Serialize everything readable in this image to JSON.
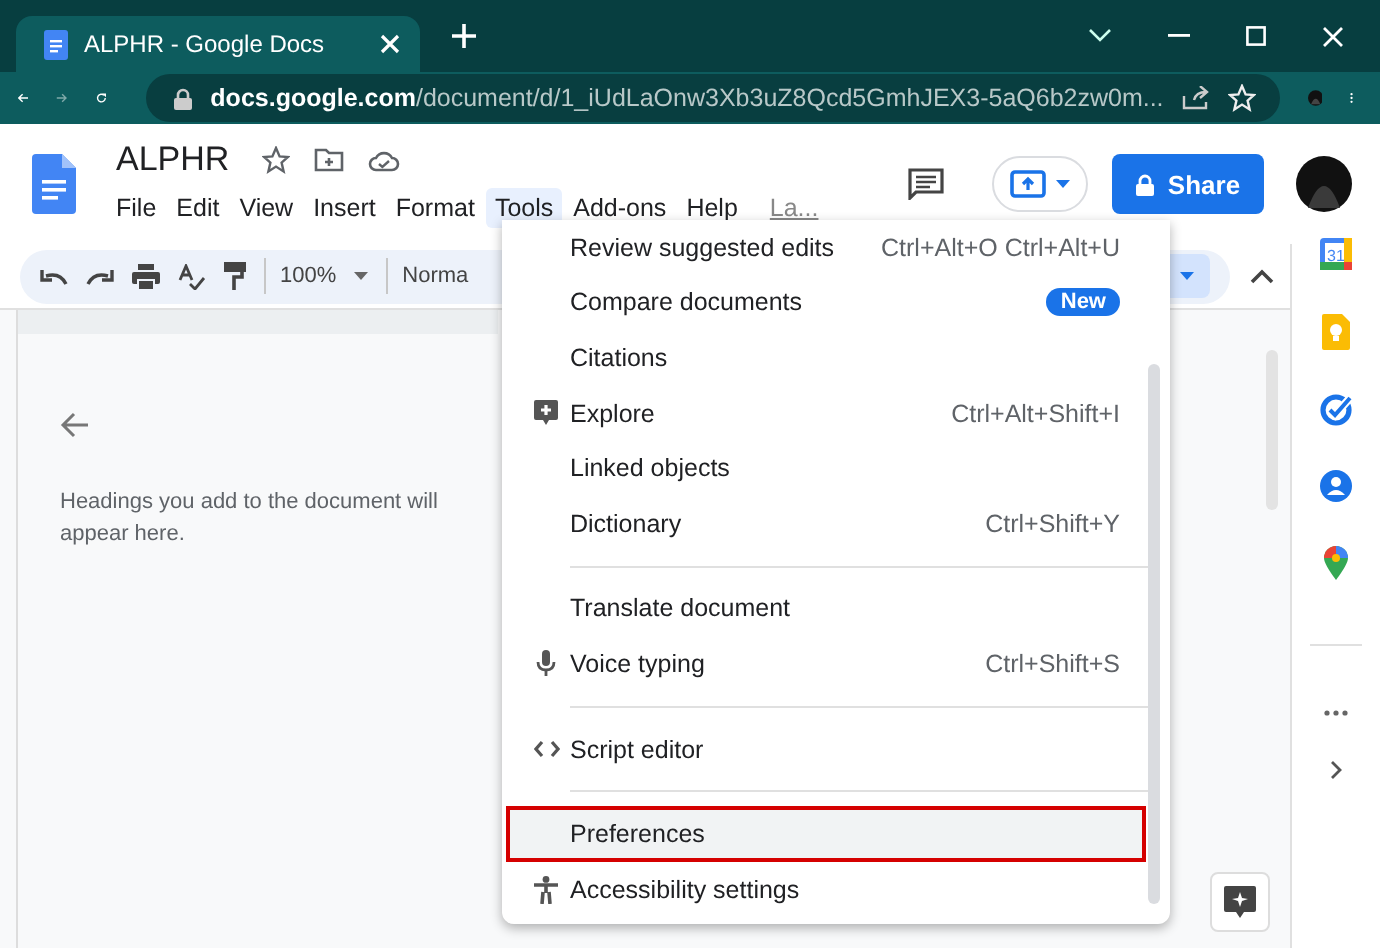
{
  "browser": {
    "tab_title": "ALPHR - Google Docs",
    "url_host": "docs.google.com",
    "url_path": "/document/d/1_iUdLaOnw3Xb3uZ8Qcd5GmhJEX3-5aQ6b2zw0m..."
  },
  "document": {
    "title": "ALPHR"
  },
  "menu_bar": [
    {
      "label": "File",
      "selected": false,
      "kind": "menu"
    },
    {
      "label": "Edit",
      "selected": false,
      "kind": "menu"
    },
    {
      "label": "View",
      "selected": false,
      "kind": "menu"
    },
    {
      "label": "Insert",
      "selected": false,
      "kind": "menu"
    },
    {
      "label": "Format",
      "selected": false,
      "kind": "menu"
    },
    {
      "label": "Tools",
      "selected": true,
      "kind": "menu"
    },
    {
      "label": "Add-ons",
      "selected": false,
      "kind": "menu"
    },
    {
      "label": "Help",
      "selected": false,
      "kind": "menu"
    },
    {
      "label": "La...",
      "selected": false,
      "kind": "link"
    }
  ],
  "share_button": "Share",
  "toolbar": {
    "zoom": "100%",
    "style": "Norma"
  },
  "outline": {
    "message": "Headings you add to the document will appear here."
  },
  "side_panel": {
    "calendar_day": "31"
  },
  "tools_menu": [
    {
      "kind": "plain",
      "label": "Review suggested edits",
      "shortcut": "Ctrl+Alt+O Ctrl+Alt+U",
      "highlighted": false
    },
    {
      "kind": "plain",
      "label": "Compare documents",
      "badge": "New",
      "highlighted": false
    },
    {
      "kind": "plain",
      "label": "Citations",
      "highlighted": false
    },
    {
      "kind": "explore",
      "label": "Explore",
      "shortcut": "Ctrl+Alt+Shift+I",
      "highlighted": false
    },
    {
      "kind": "plain",
      "label": "Linked objects",
      "highlighted": false
    },
    {
      "kind": "plain",
      "label": "Dictionary",
      "shortcut": "Ctrl+Shift+Y",
      "highlighted": false
    },
    {
      "kind": "divider"
    },
    {
      "kind": "plain",
      "label": "Translate document",
      "highlighted": false
    },
    {
      "kind": "voice",
      "label": "Voice typing",
      "shortcut": "Ctrl+Shift+S",
      "highlighted": false
    },
    {
      "kind": "divider"
    },
    {
      "kind": "script",
      "label": "Script editor",
      "highlighted": false
    },
    {
      "kind": "divider"
    },
    {
      "kind": "plain",
      "label": "Preferences",
      "highlighted": true
    },
    {
      "kind": "accessibility",
      "label": "Accessibility settings",
      "highlighted": false
    }
  ]
}
